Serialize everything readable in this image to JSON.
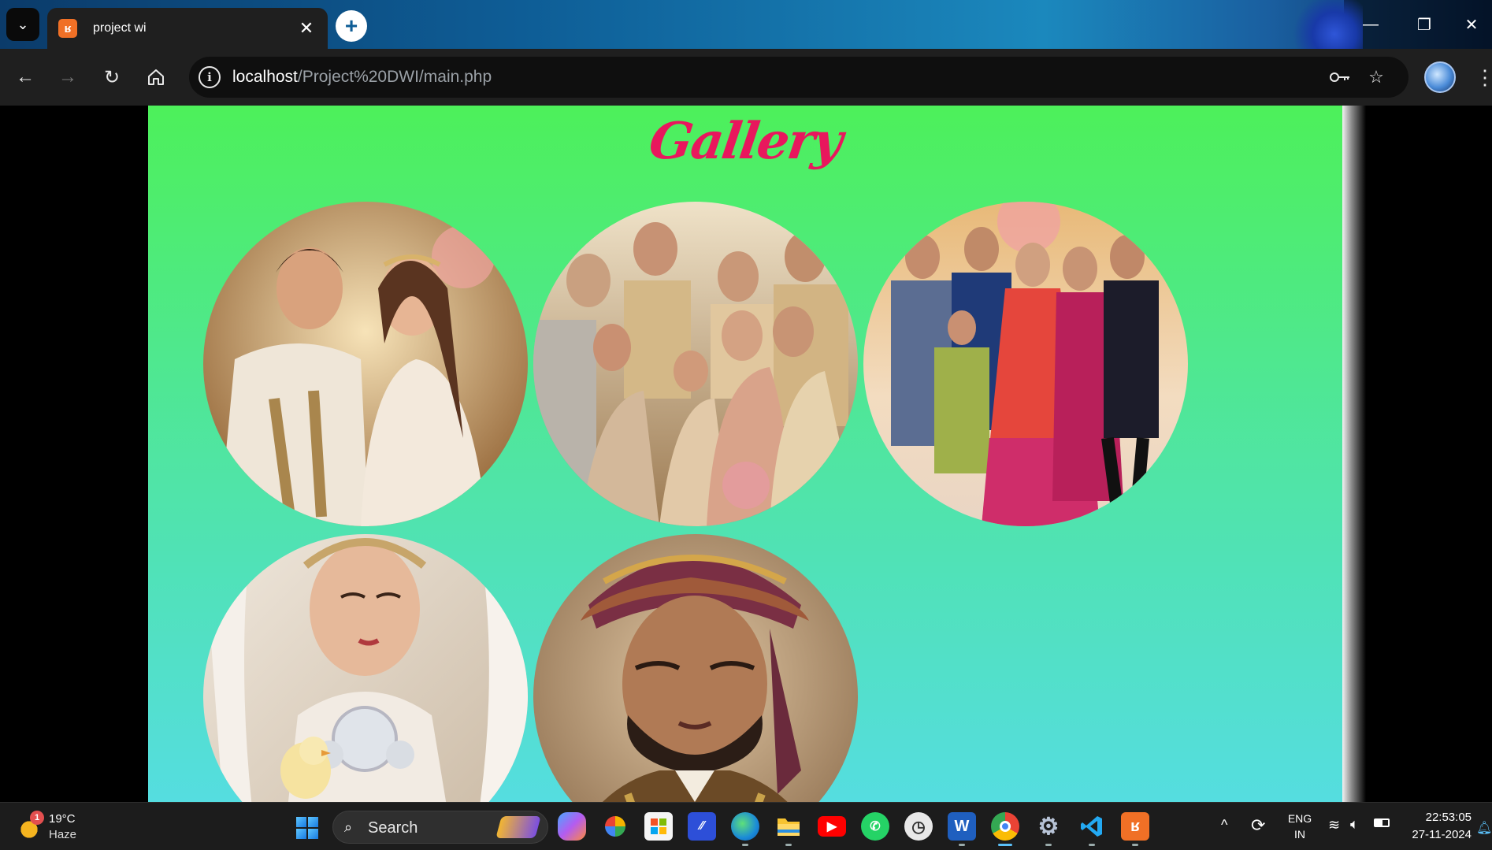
{
  "browser": {
    "tab_title": "project wi",
    "new_tab_symbol": "+",
    "url_host": "localhost",
    "url_path": "/Project%20DWI/main.php",
    "window_controls": [
      "—",
      "❐",
      "✕"
    ]
  },
  "page": {
    "heading": "Gallery",
    "colors": {
      "heading": "#e8175d",
      "background_top": "#4df05a",
      "background_bottom": "#55dde0"
    },
    "photos": [
      {
        "name": "couple-photo",
        "subject": "bride-and-groom"
      },
      {
        "name": "family-photo",
        "subject": "seated-wedding-family"
      },
      {
        "name": "group-photo",
        "subject": "standing-wedding-family"
      },
      {
        "name": "bride-photo",
        "subject": "bride-with-chick"
      },
      {
        "name": "groom-photo",
        "subject": "groom-in-turban"
      }
    ]
  },
  "taskbar": {
    "weather": {
      "badge": "1",
      "temp": "19°C",
      "desc": "Haze"
    },
    "search_label": "Search",
    "apps": [
      "copilot",
      "photos",
      "store",
      "app-blue",
      "edge",
      "file-explorer",
      "youtube",
      "whatsapp",
      "clock-app",
      "word",
      "chrome",
      "settings",
      "vscode",
      "xampp"
    ],
    "tray": {
      "language_top": "ENG",
      "language_bottom": "IN"
    },
    "clock": {
      "time": "22:53:05",
      "date": "27-11-2024"
    }
  }
}
